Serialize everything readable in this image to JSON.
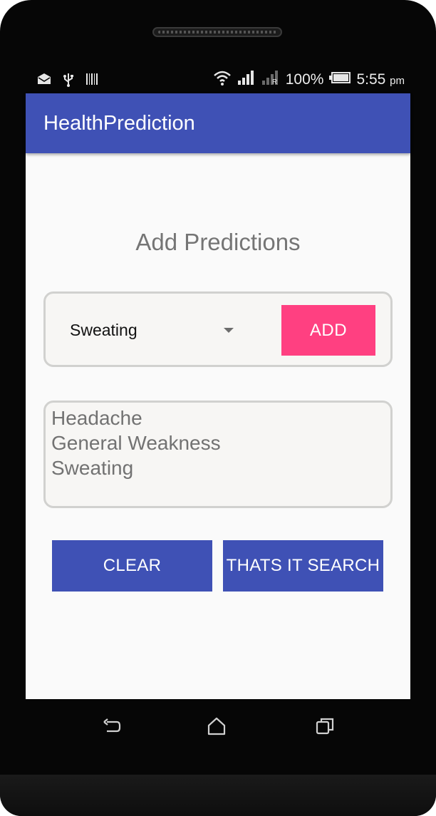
{
  "status_bar": {
    "left_icons": [
      "mail-icon",
      "usb-icon",
      "barcode-icon"
    ],
    "right_icons": [
      "wifi-icon",
      "signal-icon",
      "signal-r-icon",
      "battery-icon"
    ],
    "battery": "100%",
    "time": "5:55",
    "ampm": "pm"
  },
  "app_bar": {
    "title": "HealthPrediction",
    "color": "#3f51b5"
  },
  "main": {
    "title": "Add Predictions",
    "symptom_spinner": {
      "selected": "Sweating"
    },
    "add_label": "ADD",
    "add_color": "#ff4081",
    "selected_symptoms": [
      "Headache",
      "General Weakness",
      "Sweating"
    ],
    "clear_label": "CLEAR",
    "search_label": "THATS IT SEARCH"
  },
  "nav_bar": {
    "icons": [
      "back-icon",
      "home-icon",
      "recents-icon"
    ]
  }
}
